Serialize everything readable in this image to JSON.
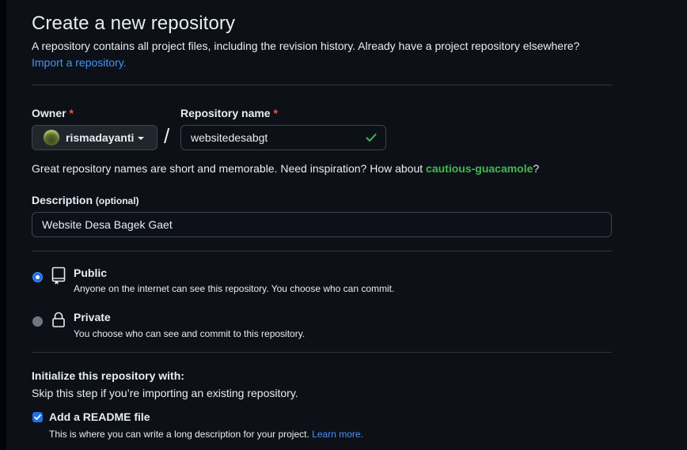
{
  "header": {
    "title": "Create a new repository",
    "subtitle": "A repository contains all project files, including the revision history. Already have a project repository elsewhere?",
    "import_link": "Import a repository."
  },
  "owner": {
    "label": "Owner",
    "required_mark": "*",
    "name": "rismadayanti"
  },
  "separator": "/",
  "repo_name": {
    "label": "Repository name",
    "required_mark": "*",
    "value": "websitedesabgt"
  },
  "name_hint": {
    "text": "Great repository names are short and memorable. Need inspiration? How about ",
    "suggestion": "cautious-guacamole",
    "end": "?"
  },
  "description": {
    "label": "Description",
    "optional": "(optional)",
    "value": "Website Desa Bagek Gaet"
  },
  "visibility": {
    "selected": "public",
    "public": {
      "title": "Public",
      "desc": "Anyone on the internet can see this repository. You choose who can commit."
    },
    "private": {
      "title": "Private",
      "desc": "You choose who can see and commit to this repository."
    }
  },
  "initialize": {
    "heading": "Initialize this repository with:",
    "sub": "Skip this step if you’re importing an existing repository.",
    "readme": {
      "checked": true,
      "label": "Add a README file",
      "desc": "This is where you can write a long description for your project.",
      "learn_more": "Learn more."
    }
  },
  "colors": {
    "background": "#0d1117",
    "text": "#e6edf3",
    "link": "#4493f8",
    "success": "#3fb950",
    "danger": "#f85149",
    "accent": "#1f6feb",
    "border": "#30363d"
  }
}
